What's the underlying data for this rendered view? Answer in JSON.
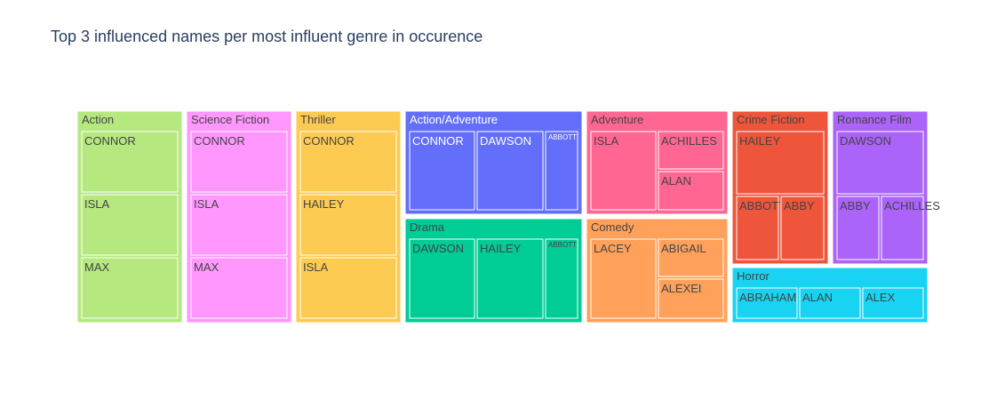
{
  "chart_data": {
    "type": "treemap",
    "title": "Top 3 influenced names per most influent genre in occurence",
    "groups": [
      {
        "name": "Action",
        "color": "#b6e880",
        "text_color": "#444444",
        "children": [
          {
            "name": "CONNOR",
            "value": 1
          },
          {
            "name": "ISLA",
            "value": 1
          },
          {
            "name": "MAX",
            "value": 1
          }
        ]
      },
      {
        "name": "Science Fiction",
        "color": "#ff97ff",
        "text_color": "#444444",
        "children": [
          {
            "name": "CONNOR",
            "value": 1
          },
          {
            "name": "ISLA",
            "value": 1
          },
          {
            "name": "MAX",
            "value": 1
          }
        ]
      },
      {
        "name": "Thriller",
        "color": "#fecb52",
        "text_color": "#444444",
        "children": [
          {
            "name": "CONNOR",
            "value": 1
          },
          {
            "name": "HAILEY",
            "value": 1
          },
          {
            "name": "ISLA",
            "value": 1
          }
        ]
      },
      {
        "name": "Action/Adventure",
        "color": "#636efa",
        "text_color": "#ffffff",
        "children": [
          {
            "name": "CONNOR",
            "value": 1
          },
          {
            "name": "DAWSON",
            "value": 1
          },
          {
            "name": "ABBOTT",
            "value": 0.45
          }
        ]
      },
      {
        "name": "Drama",
        "color": "#00cc96",
        "text_color": "#444444",
        "children": [
          {
            "name": "DAWSON",
            "value": 1
          },
          {
            "name": "HAILEY",
            "value": 1
          },
          {
            "name": "ABBOTT",
            "value": 0.45
          }
        ]
      },
      {
        "name": "Adventure",
        "color": "#ff6692",
        "text_color": "#444444",
        "children": [
          {
            "name": "ISLA",
            "value": 1
          },
          {
            "name": "ACHILLES",
            "value": 0.5
          },
          {
            "name": "ALAN",
            "value": 0.5
          }
        ]
      },
      {
        "name": "Comedy",
        "color": "#ffa15a",
        "text_color": "#444444",
        "children": [
          {
            "name": "LACEY",
            "value": 1
          },
          {
            "name": "ABIGAIL",
            "value": 0.5
          },
          {
            "name": "ALEXEI",
            "value": 0.5
          }
        ]
      },
      {
        "name": "Crime Fiction",
        "color": "#ef553b",
        "text_color": "#444444",
        "children": [
          {
            "name": "HAILEY",
            "value": 1
          },
          {
            "name": "ABBOTT",
            "value": 0.5
          },
          {
            "name": "ABBY",
            "value": 0.5
          }
        ]
      },
      {
        "name": "Romance Film",
        "color": "#ab63fa",
        "text_color": "#444444",
        "children": [
          {
            "name": "DAWSON",
            "value": 1
          },
          {
            "name": "ABBY",
            "value": 0.5
          },
          {
            "name": "ACHILLES",
            "value": 0.5
          }
        ]
      },
      {
        "name": "Horror",
        "color": "#19d3f3",
        "text_color": "#444444",
        "children": [
          {
            "name": "ABRAHAM",
            "value": 1
          },
          {
            "name": "ALAN",
            "value": 1
          },
          {
            "name": "ALEX",
            "value": 1
          }
        ]
      }
    ]
  }
}
